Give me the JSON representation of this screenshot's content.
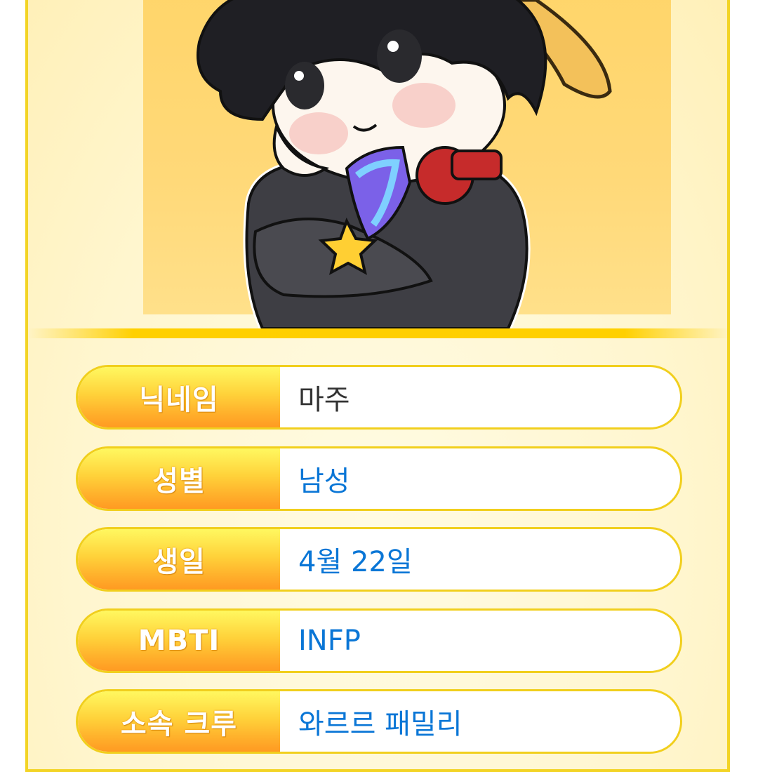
{
  "profile": {
    "rows": [
      {
        "label": "닉네임",
        "value": "마주"
      },
      {
        "label": "성별",
        "value": "남성"
      },
      {
        "label": "생일",
        "value": "4월 22일"
      },
      {
        "label": "MBTI",
        "value": "INFP"
      },
      {
        "label": "소속 크루",
        "value": "와르르 패밀리"
      }
    ]
  },
  "colors": {
    "frame": "#f3d425",
    "label_gradient_top": "#fff860",
    "label_gradient_bottom": "#ff9a22",
    "value_text": "#0a76d6",
    "nickname_text": "#333333"
  },
  "icons": {
    "portrait": "chibi-character-illustration"
  }
}
